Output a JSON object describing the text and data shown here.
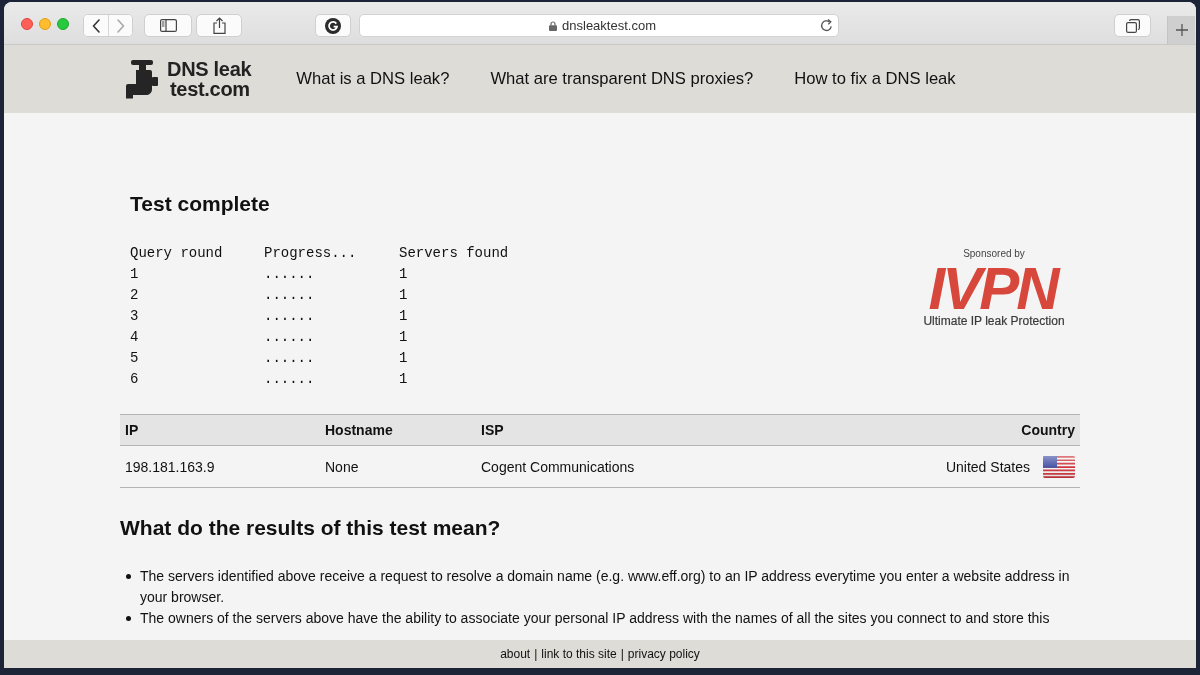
{
  "browser": {
    "nav_buttons": [
      {
        "kind": "back",
        "disabled": false
      },
      {
        "kind": "forward",
        "disabled": true
      }
    ],
    "address": "dnsleaktest.com"
  },
  "site_header": {
    "logo": [
      "DNS leak",
      "test.com"
    ],
    "nav": [
      "What is a DNS leak?",
      "What are transparent DNS proxies?",
      "How to fix a DNS leak"
    ]
  },
  "test": {
    "title": "Test complete",
    "columns": [
      "Query round",
      "Progress...",
      "Servers found"
    ],
    "rounds": [
      [
        "1",
        "......",
        "1"
      ],
      [
        "2",
        "......",
        "1"
      ],
      [
        "3",
        "......",
        "1"
      ],
      [
        "4",
        "......",
        "1"
      ],
      [
        "5",
        "......",
        "1"
      ],
      [
        "6",
        "......",
        "1"
      ]
    ]
  },
  "sponsor": {
    "label": "Sponsored by",
    "name": "IVPN",
    "tagline": "Ultimate IP leak Protection"
  },
  "results": {
    "columns": [
      "IP",
      "Hostname",
      "ISP",
      "Country"
    ],
    "rows": [
      [
        "198.181.163.9",
        "None",
        "Cogent Communications",
        "United States"
      ]
    ]
  },
  "explanation": {
    "title": "What do the results of this test mean?",
    "points": [
      "The servers identified above receive a request to resolve a domain name (e.g. www.eff.org) to an IP address everytime you enter a website address in your browser.",
      "The owners of the servers above have the ability to associate your personal IP address with the names of all the sites you connect to and store this"
    ]
  },
  "footer": {
    "links": [
      {
        "text": "about",
        "separator": "|"
      },
      {
        "text": "link to this site",
        "separator": "|"
      },
      {
        "text": "privacy policy"
      }
    ]
  }
}
